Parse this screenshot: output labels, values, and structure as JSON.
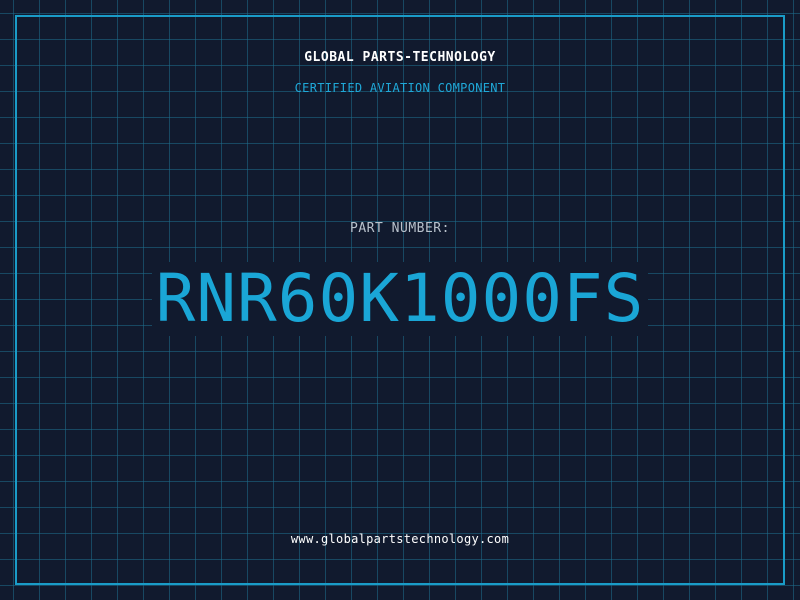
{
  "header": {
    "company": "GLOBAL PARTS-TECHNOLOGY",
    "tagline": "CERTIFIED AVIATION COMPONENT"
  },
  "part": {
    "label": "PART NUMBER:",
    "number": "RNR60K1000FS"
  },
  "footer": {
    "url": "www.globalpartstechnology.com"
  },
  "colors": {
    "background": "#111a2e",
    "grid": "#1e6e8c",
    "accent": "#1aa6d6",
    "frame": "#1a9cc8"
  }
}
